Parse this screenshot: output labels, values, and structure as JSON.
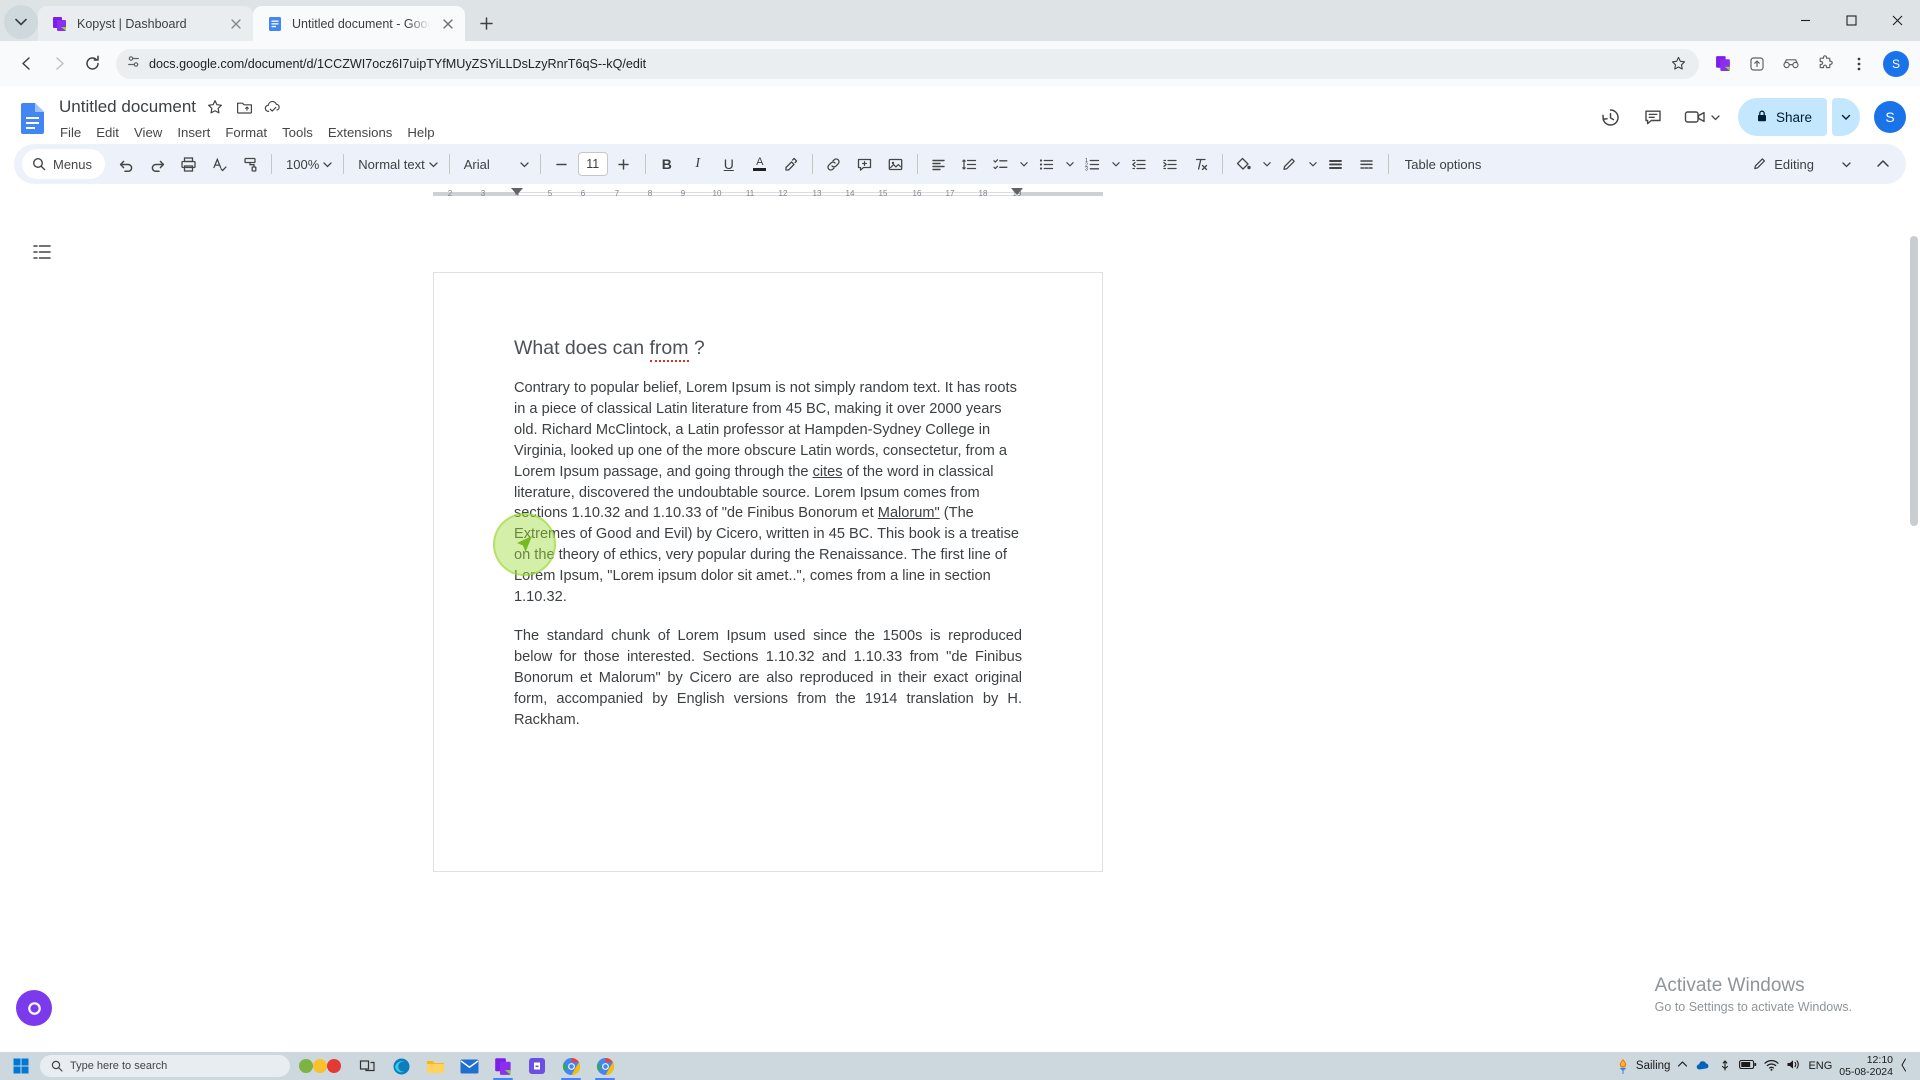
{
  "browser": {
    "tabs": [
      {
        "title": "Kopyst | Dashboard",
        "favicon": "kopyst-icon",
        "active": false
      },
      {
        "title": "Untitled document - Google Do",
        "favicon": "google-docs-icon",
        "active": true
      }
    ],
    "new_tab_label": "+",
    "window_controls": {
      "minimize": "—",
      "maximize": "□",
      "close": "✕"
    },
    "url": "docs.google.com/document/d/1CCZWI7ocz6I7uipTYfMUyZSYiLLDsLzyRnrT6qS--kQ/edit",
    "profile_initial": "S",
    "nav": {
      "back": "back-arrow",
      "forward": "forward-arrow",
      "reload": "reload-icon"
    }
  },
  "docs": {
    "title": "Untitled document",
    "title_icons": [
      "star-icon",
      "move-to-folder-icon",
      "cloud-saved-icon"
    ],
    "menus": [
      "File",
      "Edit",
      "View",
      "Insert",
      "Format",
      "Tools",
      "Extensions",
      "Help"
    ],
    "header_right": {
      "history_icon": "version-history-icon",
      "comment_icon": "comment-icon",
      "meet_icon": "google-meet-icon",
      "share_label": "Share",
      "account_initial": "S"
    },
    "toolbar": {
      "menus_search_label": "Menus",
      "zoom_value": "100%",
      "style_value": "Normal text",
      "font_value": "Arial",
      "font_size": "11",
      "decrease_label": "−",
      "increase_label": "+",
      "bold_label": "B",
      "italic_label": "I",
      "underline_label": "U",
      "text_color_label": "A",
      "table_options_label": "Table options",
      "editing_label": "Editing"
    },
    "ruler": {
      "ticks": [
        "2",
        "3",
        "4",
        "5",
        "6",
        "7",
        "8",
        "9",
        "10",
        "11",
        "12",
        "13",
        "14",
        "15",
        "16",
        "17",
        "18",
        "19"
      ]
    },
    "document": {
      "heading_parts": [
        {
          "text": "What does can ",
          "spell": false
        },
        {
          "text": "from",
          "spell": true
        },
        {
          "text": " ?",
          "spell": false
        }
      ],
      "heading_plain": "What does can from ?",
      "paragraph_1_pre": "Contrary to popular belief, Lorem Ipsum is not simply random text. It has roots in a piece of classical Latin literature from 45 BC, making it over 2000 years old. Richard McClintock, a Latin professor at Hampden-Sydney College in Virginia, looked up one of the more obscure Latin words, consectetur, from a Lorem Ipsum passage, and going through the ",
      "paragraph_1_link1": "cites",
      "paragraph_1_mid": " of the word in classical literature, discovered the undoubtable source. Lorem Ipsum comes from sections 1.10.32 and 1.10.33 of \"de Finibus Bonorum et ",
      "paragraph_1_link2": "Malorum\"",
      "paragraph_1_post": " (The Extremes of Good and Evil) by Cicero, written in 45 BC. This book is a treatise on the theory of ethics, very popular during the Renaissance. The first line of Lorem Ipsum, \"Lorem ipsum dolor sit amet..\", comes from a line in section 1.10.32.",
      "paragraph_2": "The standard chunk of Lorem Ipsum used since the 1500s is reproduced below for those interested. Sections 1.10.32 and 1.10.33 from \"de Finibus Bonorum et Malorum\" by Cicero are also reproduced in their exact original form, accompanied by English versions from the 1914 translation by H. Rackham."
    },
    "watermark": {
      "title": "Activate Windows",
      "subtitle": "Go to Settings to activate Windows."
    }
  },
  "taskbar": {
    "search_placeholder": "Type here to search",
    "weather_label": "Sailing",
    "language": "ENG",
    "time": "12:10",
    "date": "05-08-2024",
    "apps": [
      "task-view-icon",
      "edge-icon",
      "file-explorer-icon",
      "mail-icon",
      "kopyst-icon",
      "store-icon",
      "chrome-app-icon",
      "chrome-active-icon"
    ]
  },
  "colors": {
    "accent_blue": "#1a73e8",
    "toolbar_bg": "#edf2fa",
    "share_bg": "#c2e7ff",
    "taskbar_bg": "#cdd7de",
    "cursor_green": "#a0dc3c",
    "spell_red": "#d93025"
  }
}
